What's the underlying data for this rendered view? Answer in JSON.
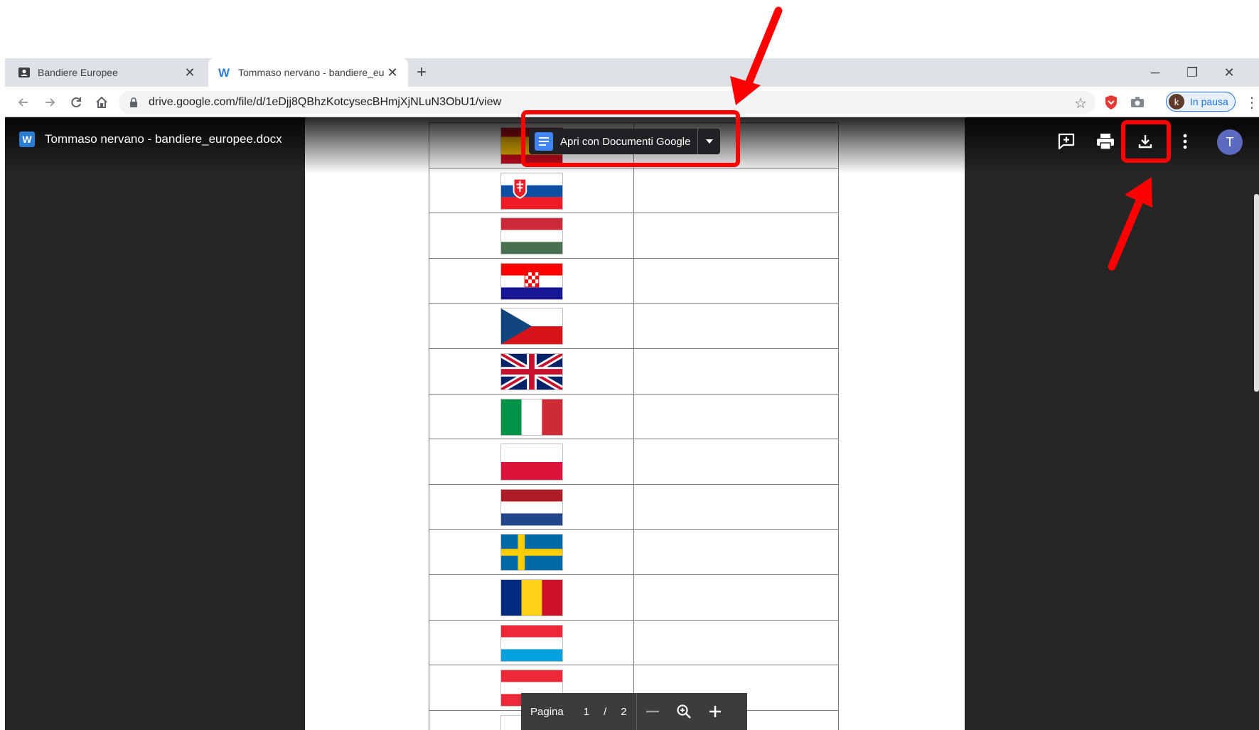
{
  "browser": {
    "tabs": [
      {
        "title": "Bandiere Europee",
        "active": false
      },
      {
        "title": "Tommaso nervano - bandiere_eu",
        "active": true
      }
    ],
    "address_url": "drive.google.com/file/d/1eDjj8QBhzKotcysecBHmjXjNLuN3ObU1/view",
    "profile_label": "In pausa",
    "profile_initial": "k"
  },
  "viewer": {
    "file_name": "Tommaso nervano - bandiere_europee.docx",
    "file_icon_letter": "W",
    "open_with_label": "Apri con Documenti Google",
    "user_initial": "T",
    "page_label": "Pagina",
    "current_page": "1",
    "page_sep": "/",
    "total_pages": "2"
  },
  "document": {
    "flags": [
      "spain",
      "slovakia",
      "hungary",
      "croatia",
      "czech-republic",
      "united-kingdom",
      "italy",
      "poland",
      "netherlands",
      "sweden",
      "romania",
      "luxembourg",
      "austria",
      "partial"
    ]
  },
  "colors": {
    "annotation": "#ff0000",
    "viewer_bg": "#262626",
    "accent_blue": "#1a73e8"
  }
}
